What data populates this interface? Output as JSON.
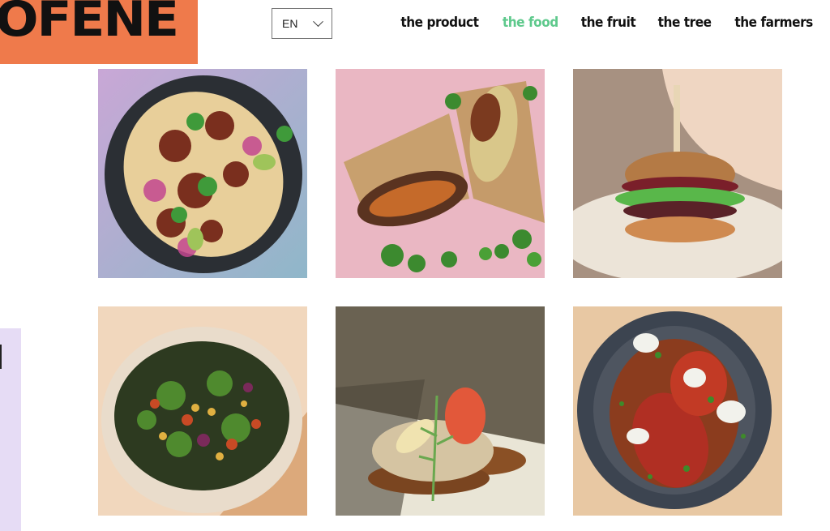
{
  "logo": {
    "text": "OFENE"
  },
  "language": {
    "selected": "EN"
  },
  "nav": [
    {
      "label": "the product",
      "active": false
    },
    {
      "label": "the food",
      "active": true
    },
    {
      "label": "the fruit",
      "active": false
    },
    {
      "label": "the tree",
      "active": false
    },
    {
      "label": "the farmers",
      "active": false
    }
  ],
  "colors": {
    "brand_orange": "#ef7a4b",
    "active_green": "#5ec98c",
    "side_lavender": "#e6dcf5"
  },
  "gallery": [
    {
      "name": "tacos"
    },
    {
      "name": "burrito-wrap"
    },
    {
      "name": "burger"
    },
    {
      "name": "salad-bowl"
    },
    {
      "name": "open-sandwich"
    },
    {
      "name": "stew-bowl"
    }
  ]
}
